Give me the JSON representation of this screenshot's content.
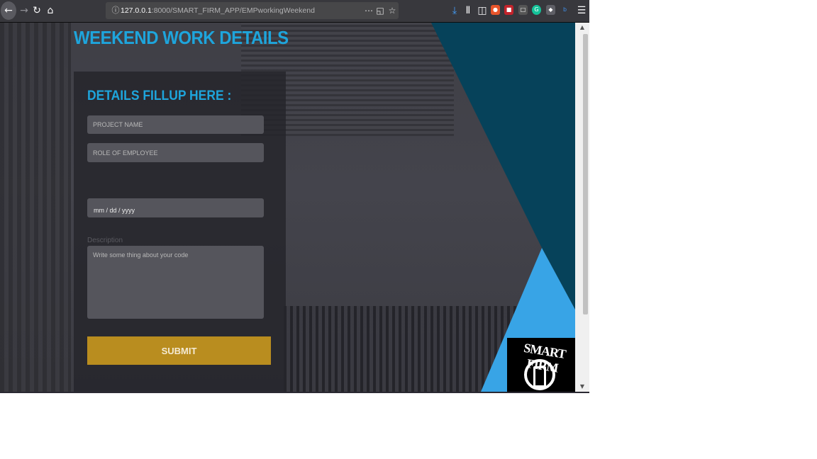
{
  "browser": {
    "url_host": "127.0.0.1",
    "url_path": ":8000/SMART_FIRM_APP/EMPworkingWeekend",
    "icons": {
      "back": "back-arrow-icon",
      "forward": "forward-arrow-icon",
      "reload": "reload-icon",
      "home": "home-icon",
      "page_info": "info-icon",
      "page_actions": "more-actions-icon",
      "pocket": "pocket-icon",
      "bookmark": "star-icon",
      "download": "download-icon",
      "library": "library-icon",
      "sidebar": "sidebar-icon",
      "menu": "hamburger-menu-icon"
    }
  },
  "page": {
    "title": "WEEKEND WORK DETAILS",
    "form": {
      "heading": "DETAILS FILLUP HERE :",
      "project_placeholder": "PROJECT NAME",
      "role_placeholder": "ROLE OF EMPLOYEE",
      "date_value": "mm / dd / yyyy",
      "description_label": "Description",
      "description_placeholder": "Write some thing about your code",
      "submit_label": "SUBMIT"
    },
    "logo_text": "SMART FIRM"
  },
  "colors": {
    "accent": "#1ea5dc",
    "submit": "#b98d1f",
    "teal": "#06425a",
    "sky": "#38a4e6"
  }
}
